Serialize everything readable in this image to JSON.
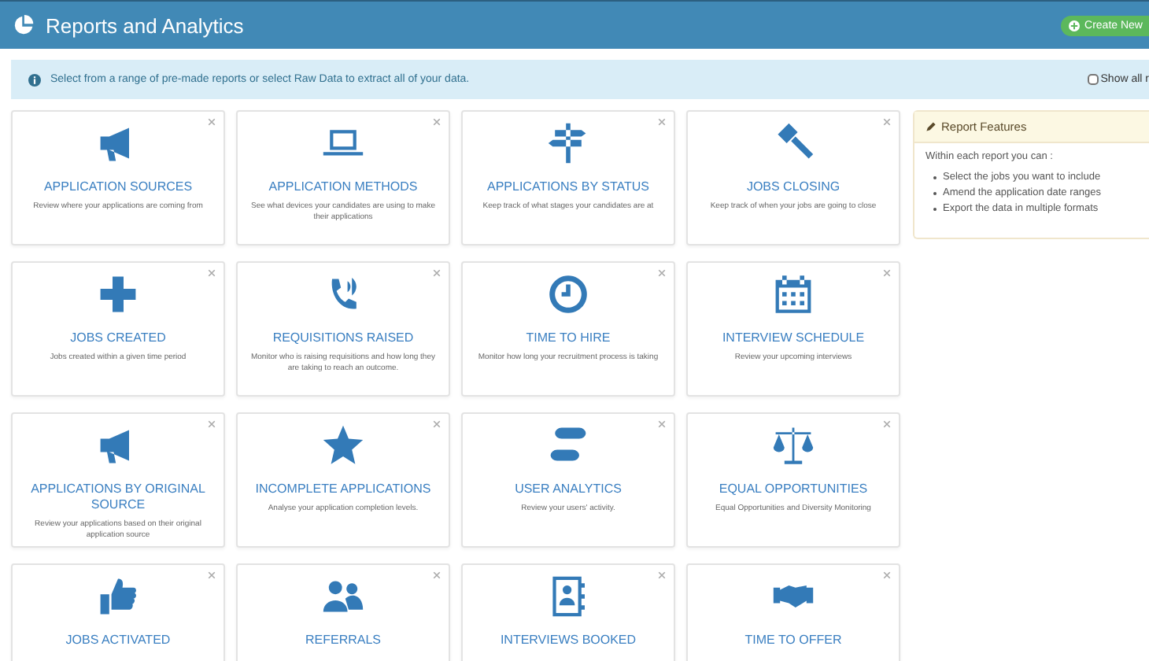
{
  "header": {
    "title": "Reports and Analytics",
    "create_button": "Create New"
  },
  "info_bar": {
    "text": "Select from a range of pre-made reports or select Raw Data to extract all of your data.",
    "show_all": {
      "label": "Show all r",
      "checked": false
    }
  },
  "reports": [
    {
      "title": "APPLICATION SOURCES",
      "description": "Review where your applications are coming from"
    },
    {
      "title": "APPLICATION METHODS",
      "description": "See what devices your candidates are using to make their applications"
    },
    {
      "title": "APPLICATIONS BY STATUS",
      "description": "Keep track of what stages your candidates are at"
    },
    {
      "title": "JOBS CLOSING",
      "description": "Keep track of when your jobs are going to close"
    },
    {
      "title": "JOBS CREATED",
      "description": "Jobs created within a given time period"
    },
    {
      "title": "REQUISITIONS RAISED",
      "description": "Monitor who is raising requisitions and how long they are taking to reach an outcome."
    },
    {
      "title": "TIME TO HIRE",
      "description": "Monitor how long your recruitment process is taking"
    },
    {
      "title": "INTERVIEW SCHEDULE",
      "description": "Review your upcoming interviews"
    },
    {
      "title": "APPLICATIONS BY ORIGINAL SOURCE",
      "description": "Review your applications based on their original application source"
    },
    {
      "title": "INCOMPLETE APPLICATIONS",
      "description": "Analyse your application completion levels."
    },
    {
      "title": "USER ANALYTICS",
      "description": "Review your users' activity."
    },
    {
      "title": "EQUAL OPPORTUNITIES",
      "description": "Equal Opportunities and Diversity Monitoring"
    },
    {
      "title": "JOBS ACTIVATED"
    },
    {
      "title": "REFERRALS"
    },
    {
      "title": "INTERVIEWS BOOKED"
    },
    {
      "title": "TIME TO OFFER"
    }
  ],
  "features_panel": {
    "title": "Report Features",
    "intro": "Within each report you can :",
    "items": [
      "Select the jobs you want to include",
      "Amend the application date ranges",
      "Export the data in multiple formats"
    ]
  }
}
